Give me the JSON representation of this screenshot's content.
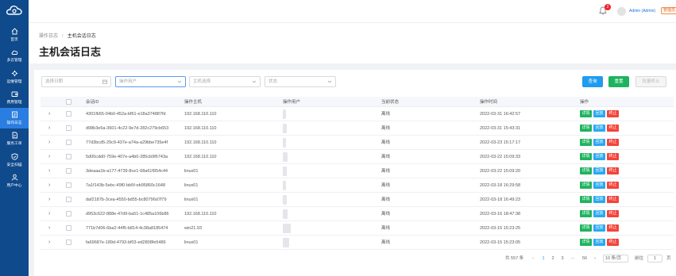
{
  "topbar": {
    "notification_count": "2",
    "username": "Admin (Admin)",
    "role": "管理员"
  },
  "sidebar": {
    "items": [
      {
        "label": "首页",
        "icon": "home-icon"
      },
      {
        "label": "多云管理",
        "icon": "cloud-icon"
      },
      {
        "label": "运维管理",
        "icon": "ops-icon"
      },
      {
        "label": "费用管理",
        "icon": "wallet-icon"
      },
      {
        "label": "操作日志",
        "icon": "log-icon",
        "active": true
      },
      {
        "label": "服务工单",
        "icon": "ticket-icon"
      },
      {
        "label": "安全扫描",
        "icon": "shield-icon"
      },
      {
        "label": "用户中心",
        "icon": "user-icon"
      }
    ]
  },
  "header": {
    "breadcrumb_parent": "操作日志",
    "breadcrumb_sep": "/",
    "breadcrumb_current": "主机会话日志",
    "title": "主机会话日志"
  },
  "filters": {
    "date_placeholder": "选择日期",
    "user_placeholder": "操作用户",
    "host_placeholder": "主机选择",
    "status_placeholder": "状态"
  },
  "buttons": {
    "search": "查询",
    "reset": "重置",
    "batch_stop": "批量终止"
  },
  "table": {
    "columns": [
      "会话ID",
      "操作主机",
      "操作用户",
      "当前状态",
      "操作时间",
      "操作"
    ],
    "action_labels": {
      "detail": "详情",
      "replay": "回放",
      "stop": "终止"
    },
    "rows": [
      {
        "id": "4301fb55-04b0-452a-bf61-e18a374887fd",
        "host": "192.168.110.110",
        "status": "离线",
        "time": "2022-03-31 16:42:57"
      },
      {
        "id": "d98b3e6a-3601-4c22-9e7d-282c279cb653",
        "host": "192.168.110.110",
        "status": "离线",
        "time": "2022-03-31 15:43:31"
      },
      {
        "id": "77d3bcd5-29c9-437e-a74a-a29bbe735e4f",
        "host": "192.168.110.110",
        "status": "离线",
        "time": "2022-03-23 15:17:17"
      },
      {
        "id": "5d00cdd0-759e-407e-a4b0-285cb9f6743a",
        "host": "192.168.110.110",
        "status": "离线",
        "time": "2022-03-22 15:09:33"
      },
      {
        "id": "3deaaa1b-a177-4739-8ce1-68a61f954c44",
        "host": "linux01",
        "status": "离线",
        "time": "2022-03-22 15:09:20"
      },
      {
        "id": "7a1f143b-5ebc-49f0-bb5f-eb95860c1648",
        "host": "linux01",
        "status": "离线",
        "time": "2022-03-18 16:29:58"
      },
      {
        "id": "daf2187b-3cea-4550-bd55-bc80796d7f79",
        "host": "linux01",
        "status": "离线",
        "time": "2022-03-18 16:49:23"
      },
      {
        "id": "d953c622-888e-47d9-ba51-1c485a106b86",
        "host": "192.168.110.110",
        "status": "离线",
        "time": "2022-03-16 18:47:38"
      },
      {
        "id": "771b7d06-6ba2-44f5-b814-4c38a8185474",
        "host": "win21.93",
        "status": "离线",
        "time": "2022-03-15 15:23:25"
      },
      {
        "id": "fa69687e-189d-4793-bf03-ed2808fe5489",
        "host": "linux01",
        "status": "离线",
        "time": "2022-03-15 15:23:05"
      }
    ]
  },
  "pagination": {
    "total": "共 557 条",
    "prev": "‹",
    "pages": [
      "1",
      "2",
      "3"
    ],
    "ellipsis": "···",
    "last": "56",
    "next": "›",
    "page_size": "10 条/页",
    "goto_label": "前往",
    "goto_value": "1",
    "page_unit": "页"
  },
  "colors": {
    "sidebar": "#0f4a8c",
    "active": "#2a7de1",
    "detail": "#1fb35f",
    "replay": "#28a9f0",
    "stop": "#f4433a"
  }
}
